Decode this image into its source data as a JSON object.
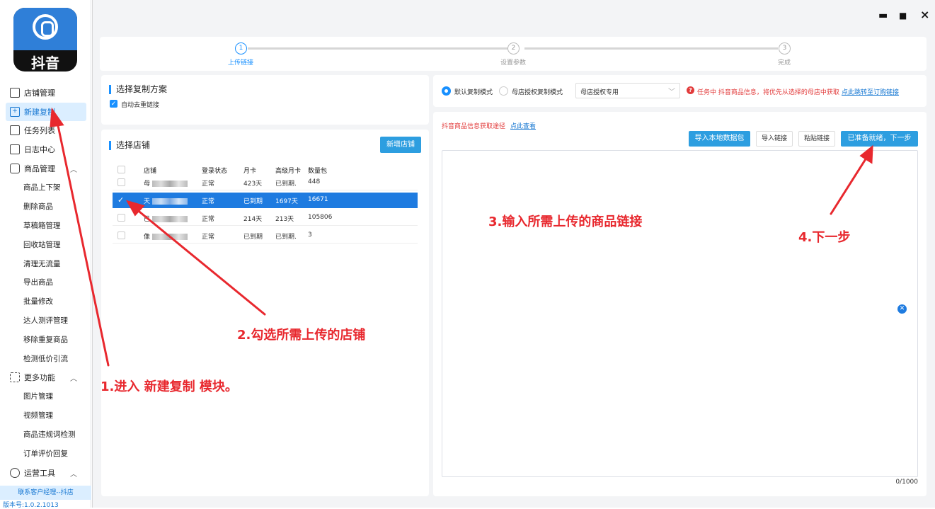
{
  "sidebar": {
    "brand": "抖音",
    "items": [
      {
        "label": "店铺管理",
        "icon": "store-icon"
      },
      {
        "label": "新建复制",
        "icon": "add-square-icon"
      },
      {
        "label": "任务列表",
        "icon": "task-list-icon"
      },
      {
        "label": "日志中心",
        "icon": "log-icon"
      },
      {
        "label": "商品管理",
        "icon": "cube-icon"
      }
    ],
    "product_sub": [
      "商品上下架",
      "删除商品",
      "草稿箱管理",
      "回收站管理",
      "清理无流量",
      "导出商品",
      "批量修改",
      "达人测评管理",
      "移除重复商品",
      "检测低价引流"
    ],
    "more_label": "更多功能",
    "more_sub": [
      "图片管理",
      "视频管理",
      "商品违规词检测",
      "订单评价回复"
    ],
    "ops_label": "运营工具",
    "contact": "联系客户经理--抖店",
    "version": "版本号:1.0.2.1013"
  },
  "window": {
    "minimize": "▬",
    "maximize": "■",
    "close": "×"
  },
  "steps": [
    {
      "num": "1",
      "label": "上传链接"
    },
    {
      "num": "2",
      "label": "设置参数"
    },
    {
      "num": "3",
      "label": "完成"
    }
  ],
  "scheme": {
    "title": "选择复制方案",
    "dedupe_label": "自动去重链接"
  },
  "stores": {
    "title": "选择店铺",
    "add_button": "新增店铺",
    "columns": [
      "店铺",
      "登录状态",
      "月卡",
      "高级月卡",
      "数量包"
    ],
    "rows": [
      {
        "name": "母",
        "status": "正常",
        "monthly": "423天",
        "premium": "已到期.",
        "pack": "448",
        "selected": false
      },
      {
        "name": "天",
        "status": "正常",
        "monthly": "已到期",
        "premium": "1697天",
        "pack": "16671",
        "selected": true
      },
      {
        "name": "已",
        "status": "正常",
        "monthly": "214天",
        "premium": "213天",
        "pack": "105806",
        "selected": false
      },
      {
        "name": "像",
        "status": "正常",
        "monthly": "已到期",
        "premium": "已到期.",
        "pack": "3",
        "selected": false
      }
    ]
  },
  "mode": {
    "default_label": "默认复制模式",
    "auth_label": "母店授权复制模式",
    "select_value": "母店授权专用",
    "warning": "任务中 抖音商品信息，将优先从选择的母店中获取",
    "warning_link": "点此跳转至订购链接"
  },
  "links": {
    "info_label": "抖音商品信息获取途径",
    "info_link": "点此查看",
    "import_pkg": "导入本地数据包",
    "import_link": "导入链接",
    "paste_link": "粘贴链接",
    "ready": "已准备就绪，下一步",
    "counter": "0/1000"
  },
  "annotations": {
    "a1": "1.进入 新建复制 模块。",
    "a2": "2.勾选所需上传的店铺",
    "a3": "3.输入所需上传的商品链接",
    "a4": "4.下一步"
  },
  "colors": {
    "accent": "#1890ff",
    "annotation": "#e8282e"
  }
}
